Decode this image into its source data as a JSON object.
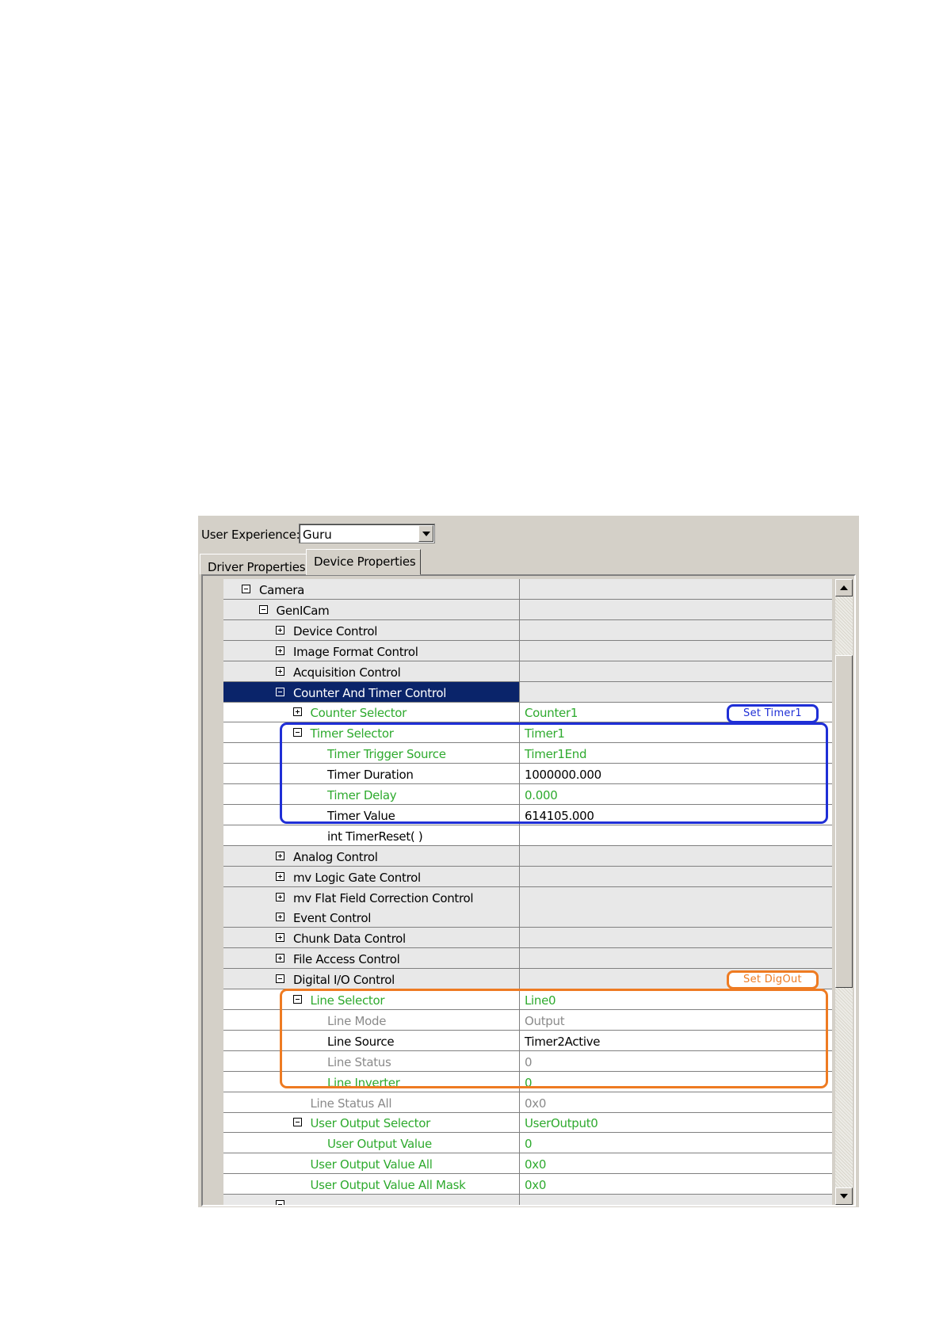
{
  "header": {
    "user_experience_label": "User Experience:",
    "user_experience_value": "Guru"
  },
  "tabs": [
    {
      "label": "Driver Properties",
      "active": false
    },
    {
      "label": "Device Properties",
      "active": true
    }
  ],
  "tree": {
    "rows": [
      {
        "label": "Camera",
        "value": "",
        "expander": "minus",
        "level": 0,
        "style": "normal",
        "kind": "cat"
      },
      {
        "label": "GenICam",
        "value": "",
        "expander": "minus",
        "level": 1,
        "style": "normal",
        "kind": "cat"
      },
      {
        "label": "Device Control",
        "value": "",
        "expander": "plus",
        "level": 2,
        "style": "normal",
        "kind": "cat"
      },
      {
        "label": "Image Format Control",
        "value": "",
        "expander": "plus",
        "level": 2,
        "style": "normal",
        "kind": "cat"
      },
      {
        "label": "Acquisition Control",
        "value": "",
        "expander": "plus",
        "level": 2,
        "style": "normal",
        "kind": "cat"
      },
      {
        "label": "Counter And Timer Control",
        "value": "",
        "expander": "minus",
        "level": 2,
        "style": "selected",
        "kind": "cat"
      },
      {
        "label": "Counter Selector",
        "value": "Counter1",
        "expander": "plus",
        "level": 3,
        "style": "green",
        "kind": "prop"
      },
      {
        "label": "Timer Selector",
        "value": "Timer1",
        "expander": "minus",
        "level": 3,
        "style": "green",
        "kind": "prop"
      },
      {
        "label": "Timer Trigger Source",
        "value": "Timer1End",
        "expander": "none",
        "level": 4,
        "style": "green",
        "kind": "prop"
      },
      {
        "label": "Timer Duration",
        "value": "1000000.000",
        "expander": "none",
        "level": 4,
        "style": "normal",
        "kind": "prop"
      },
      {
        "label": "Timer Delay",
        "value": "0.000",
        "expander": "none",
        "level": 4,
        "style": "green",
        "kind": "prop"
      },
      {
        "label": "Timer Value",
        "value": "614105.000",
        "expander": "none",
        "level": 4,
        "style": "normal",
        "kind": "prop"
      },
      {
        "label": "int TimerReset( )",
        "value": "",
        "expander": "none",
        "level": 4,
        "style": "normal",
        "kind": "prop"
      },
      {
        "label": "Analog Control",
        "value": "",
        "expander": "plus",
        "level": 2,
        "style": "normal",
        "kind": "cat"
      },
      {
        "label": "mv Logic Gate Control",
        "value": "",
        "expander": "plus",
        "level": 2,
        "style": "normal",
        "kind": "cat"
      },
      {
        "label": "mv Flat Field Correction Control",
        "value": "",
        "expander": "plus",
        "level": 2,
        "style": "normal",
        "kind": "cat"
      },
      {
        "label": "Event Control",
        "value": "",
        "expander": "plus",
        "level": 2,
        "style": "normal",
        "kind": "cat"
      },
      {
        "label": "Chunk Data Control",
        "value": "",
        "expander": "plus",
        "level": 2,
        "style": "normal",
        "kind": "cat"
      },
      {
        "label": "File Access Control",
        "value": "",
        "expander": "plus",
        "level": 2,
        "style": "normal",
        "kind": "cat"
      },
      {
        "label": "Digital I/O Control",
        "value": "",
        "expander": "minus",
        "level": 2,
        "style": "normal",
        "kind": "cat"
      },
      {
        "label": "Line Selector",
        "value": "Line0",
        "expander": "minus",
        "level": 3,
        "style": "green",
        "kind": "prop"
      },
      {
        "label": "Line Mode",
        "value": "Output",
        "expander": "none",
        "level": 4,
        "style": "gray",
        "kind": "prop"
      },
      {
        "label": "Line Source",
        "value": "Timer2Active",
        "expander": "none",
        "level": 4,
        "style": "normal",
        "kind": "prop"
      },
      {
        "label": "Line Status",
        "value": "0",
        "expander": "none",
        "level": 4,
        "style": "gray",
        "kind": "prop"
      },
      {
        "label": "Line Inverter",
        "value": "0",
        "expander": "none",
        "level": 4,
        "style": "green",
        "kind": "prop"
      },
      {
        "label": "Line Status All",
        "value": "0x0",
        "expander": "none",
        "level": 3,
        "style": "gray",
        "kind": "prop"
      },
      {
        "label": "User Output Selector",
        "value": "UserOutput0",
        "expander": "minus",
        "level": 3,
        "style": "green",
        "kind": "prop"
      },
      {
        "label": "User Output Value",
        "value": "0",
        "expander": "none",
        "level": 4,
        "style": "green",
        "kind": "prop"
      },
      {
        "label": "User Output Value All",
        "value": "0x0",
        "expander": "none",
        "level": 3,
        "style": "green",
        "kind": "prop"
      },
      {
        "label": "User Output Value All Mask",
        "value": "0x0",
        "expander": "none",
        "level": 3,
        "style": "green",
        "kind": "prop"
      },
      {
        "label": "",
        "value": "",
        "expander": "minus",
        "level": 2,
        "style": "normal",
        "kind": "cat"
      }
    ]
  },
  "annotations": {
    "timer_label": "Set Timer1",
    "digout_label": "Set DigOut",
    "timer_color": "#1f2fd6",
    "digout_color": "#ee7b22"
  },
  "colors": {
    "selection_bg": "#0a246a",
    "green_text": "#2eaa2e",
    "gray_text": "#8a8a8a",
    "window_bg": "#d4d0c8"
  },
  "icons": [
    "dropdown-arrow-icon",
    "expand-plus-icon",
    "collapse-minus-icon",
    "scroll-up-arrow-icon",
    "scroll-down-arrow-icon"
  ]
}
